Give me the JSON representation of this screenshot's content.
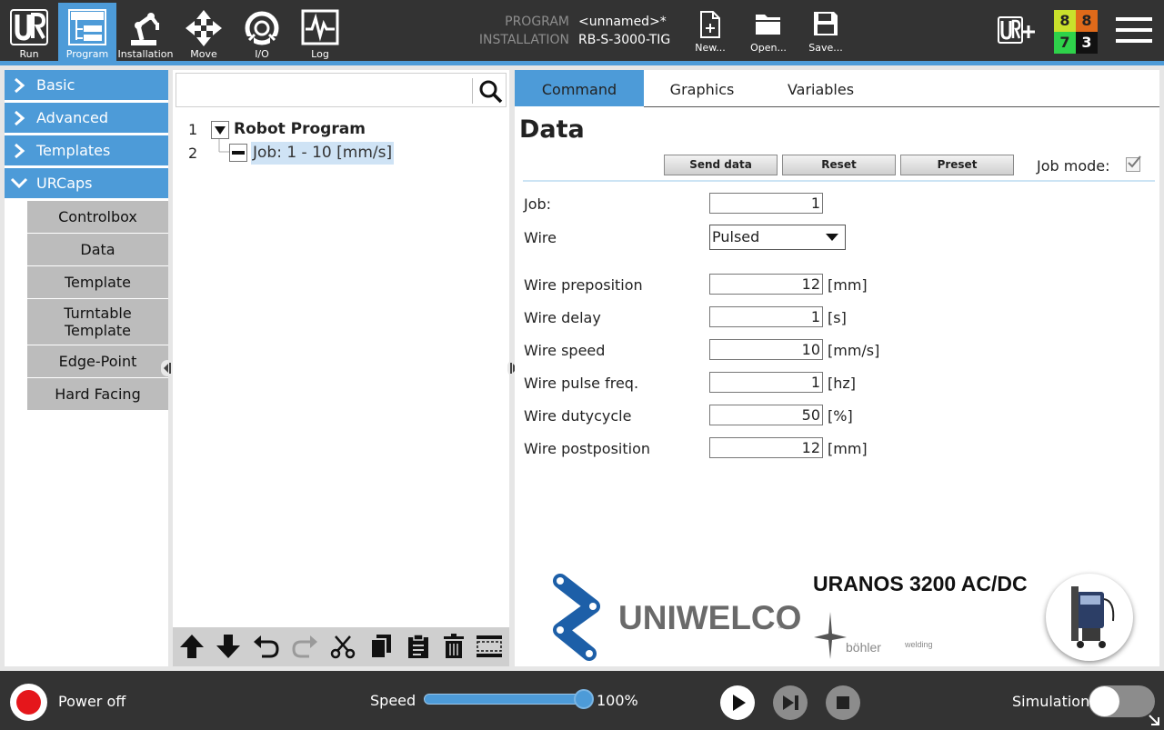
{
  "colors": {
    "header_bg": "#333333",
    "accent": "#4d9bd8",
    "power_red": "#e5161b"
  },
  "header": {
    "nav": [
      {
        "label": "Run",
        "icon": "ur-logo-icon"
      },
      {
        "label": "Program",
        "icon": "program-tree-icon"
      },
      {
        "label": "Installation",
        "icon": "robot-arm-icon"
      },
      {
        "label": "Move",
        "icon": "move-arrows-icon"
      },
      {
        "label": "I/O",
        "icon": "io-icon"
      },
      {
        "label": "Log",
        "icon": "log-icon"
      }
    ],
    "program_key": "PROGRAM",
    "program_value": "<unnamed>*",
    "installation_key": "INSTALLATION",
    "installation_value": "RB-S-3000-TIG",
    "file_new": "New...",
    "file_open": "Open...",
    "file_save": "Save...",
    "counters": [
      "8",
      "8",
      "7",
      "3"
    ]
  },
  "categories": {
    "basic": "Basic",
    "advanced": "Advanced",
    "templates": "Templates",
    "urcaps": "URCaps",
    "urcap_items": [
      "Controlbox",
      "Data",
      "Template",
      "Turntable Template",
      "Edge-Point",
      "Hard Facing"
    ]
  },
  "tree": {
    "search_placeholder": "",
    "line1": "1",
    "line2": "2",
    "root": "Robot Program",
    "node": "Job: 1 - 10 [mm/s]"
  },
  "tabs": [
    "Command",
    "Graphics",
    "Variables"
  ],
  "command": {
    "title": "Data",
    "buttons": [
      "Send data",
      "Reset",
      "Preset"
    ],
    "job_mode_label": "Job mode:",
    "job_mode_checked": true,
    "job_label": "Job:",
    "job_value": "1",
    "wire_label": "Wire",
    "wire_value": "Pulsed",
    "fields": [
      {
        "label": "Wire preposition",
        "value": "12",
        "unit": "[mm]"
      },
      {
        "label": "Wire delay",
        "value": "1",
        "unit": "[s]"
      },
      {
        "label": "Wire speed",
        "value": "10",
        "unit": "[mm/s]"
      },
      {
        "label": "Wire pulse freq.",
        "value": "1",
        "unit": "[hz]"
      },
      {
        "label": "Wire dutycycle",
        "value": "50",
        "unit": "[%]"
      },
      {
        "label": "Wire postposition",
        "value": "12",
        "unit": "[mm]"
      }
    ]
  },
  "branding": {
    "uniwelco": "UNIWELCO",
    "uniwelco_tm": "™",
    "product": "URANOS 3200 AC/DC",
    "bohler": "böhler",
    "bohler_suffix": "welding"
  },
  "footer": {
    "power_label": "Power off",
    "speed_label": "Speed",
    "speed_value": "100%",
    "speed_fraction": 1.0,
    "simulation_label": "Simulation",
    "simulation_on": false
  }
}
